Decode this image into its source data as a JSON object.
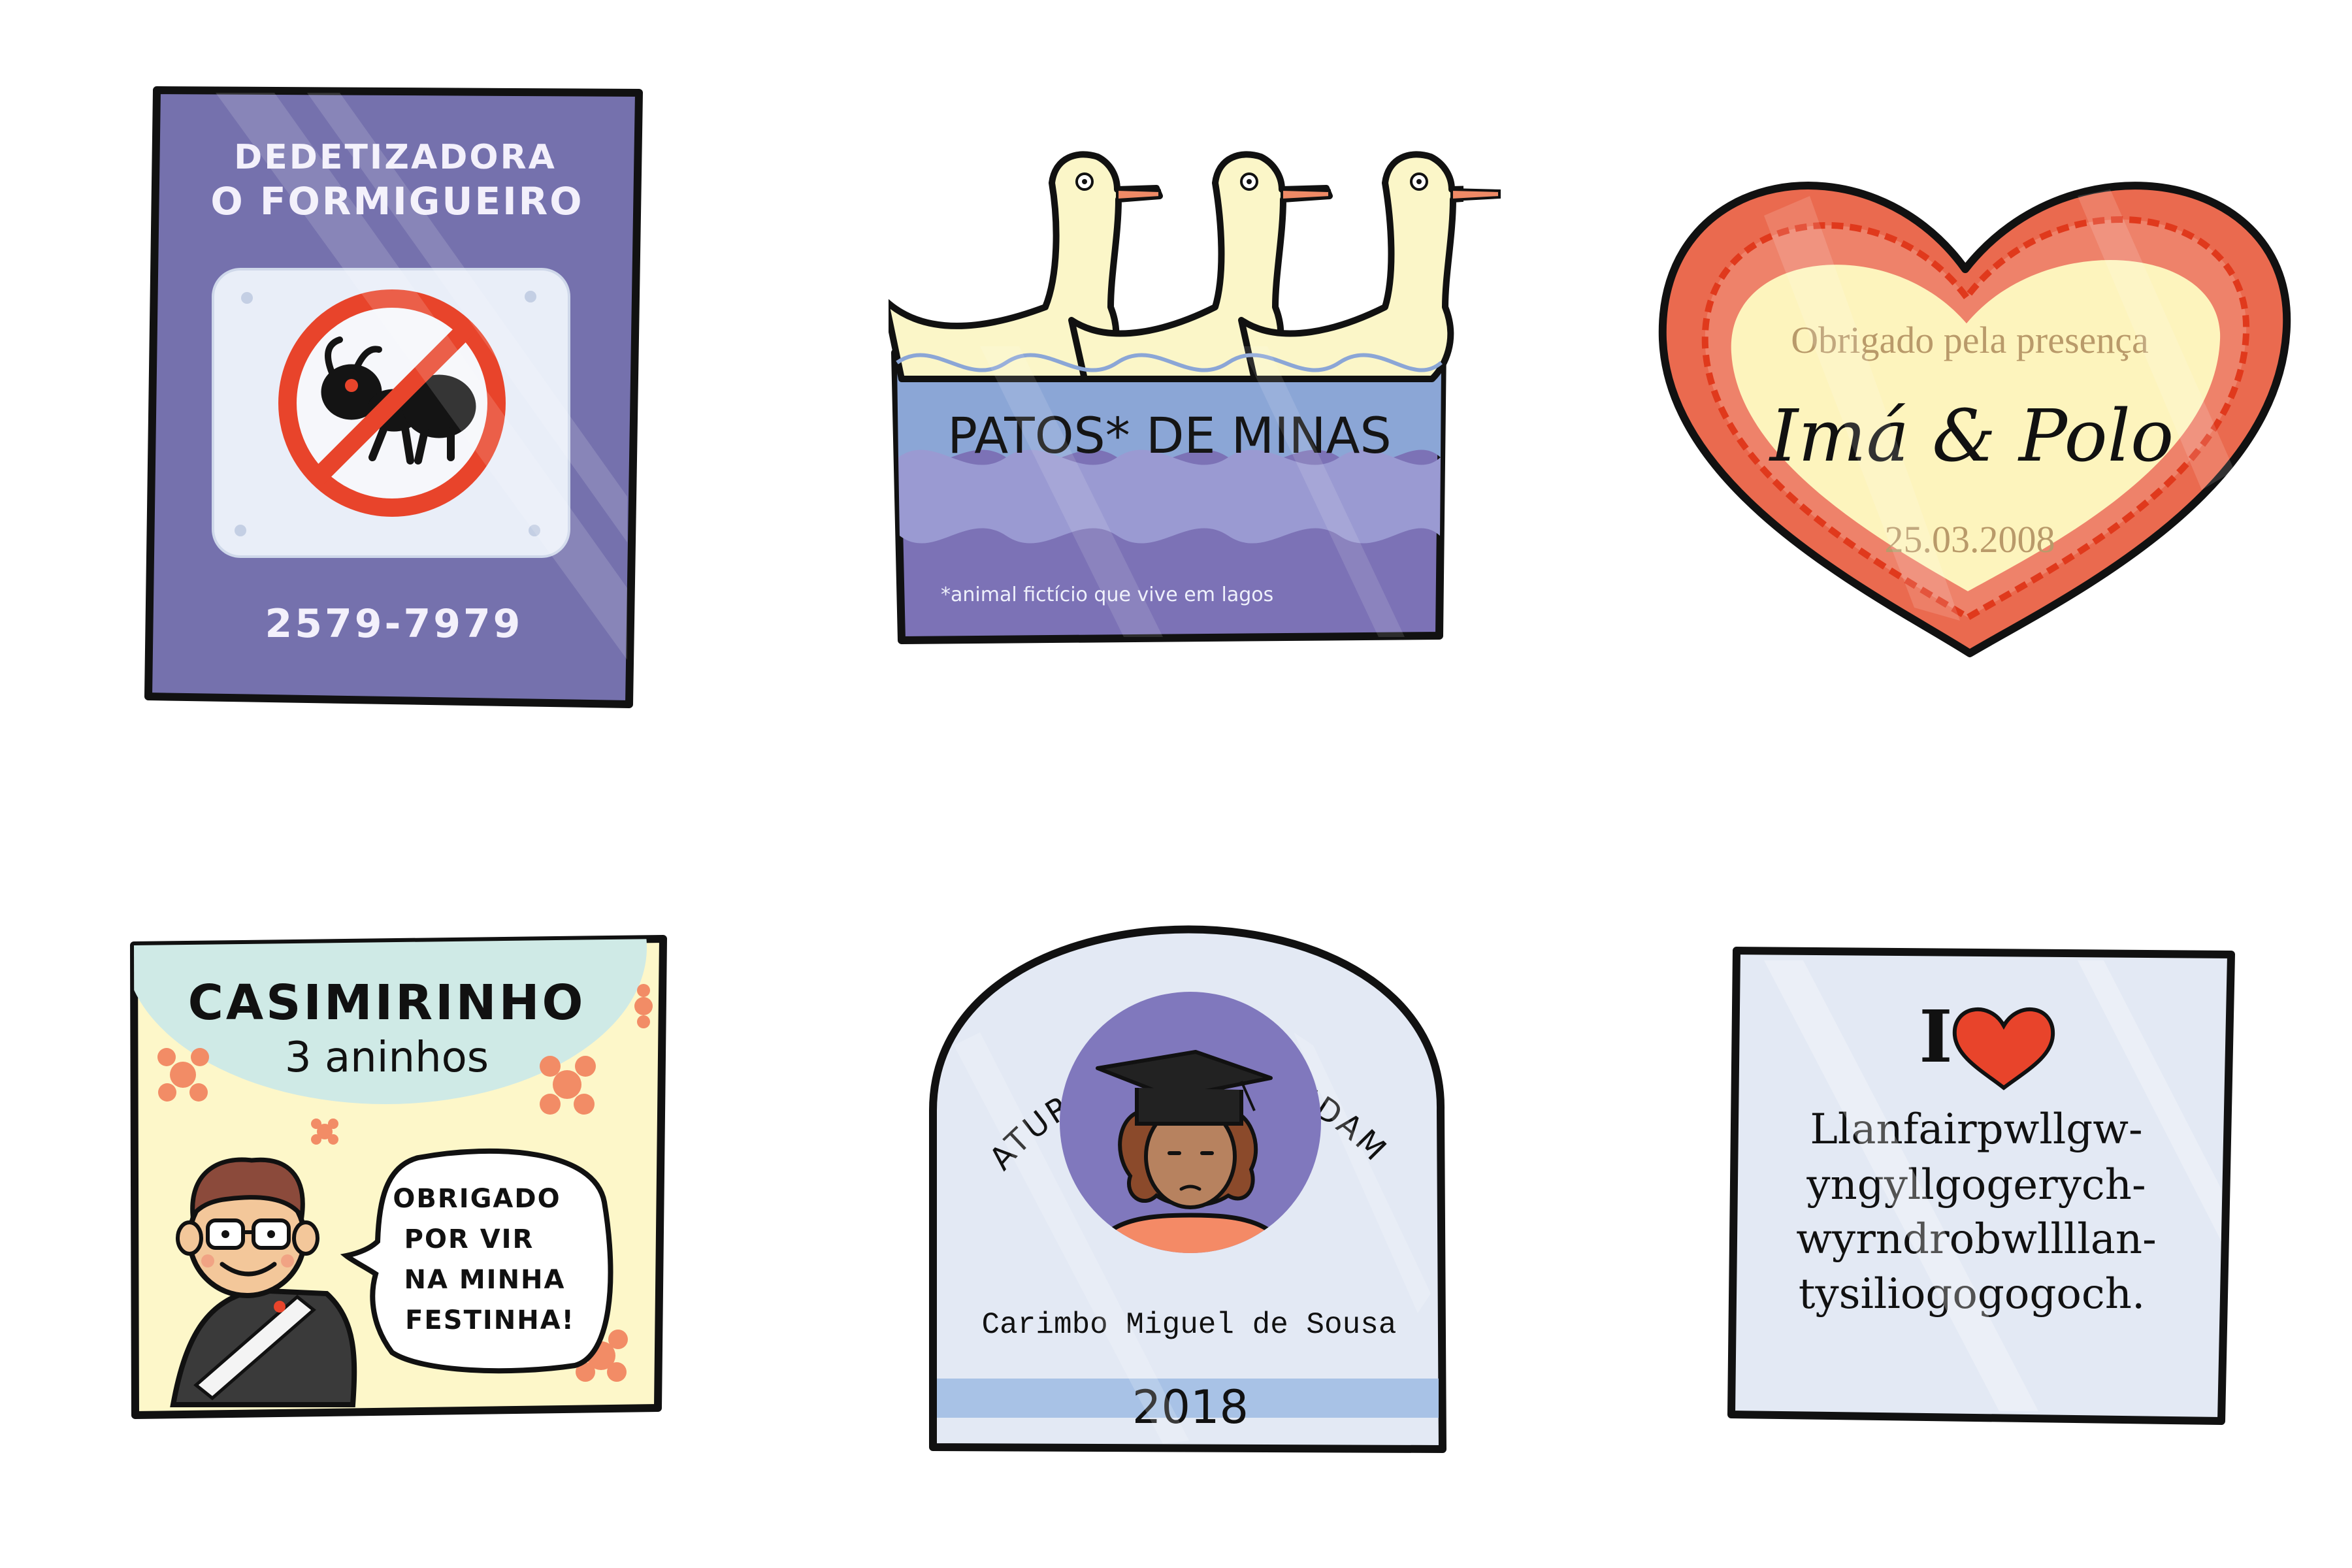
{
  "palette": {
    "background": "#ffffff",
    "outline": "#111111",
    "purple": "#7571ad",
    "purple_dark": "#6b64a8",
    "pale_blue": "#e3e9f4",
    "water_blue": "#8ba6d6",
    "water_purple": "#7c72b6",
    "duck_cream": "#fbf6c8",
    "beak_orange": "#ef8a66",
    "heart_red": "#ea4b2e",
    "heart_coral": "#ee826a",
    "heart_cream": "#fdf4bd",
    "muted_gold": "#b99a6a",
    "card_yellow": "#fdf7c9",
    "mint": "#cfeae6",
    "flower_orange": "#f28c66",
    "badge_purple": "#8078bd",
    "shirt_orange": "#f48a66",
    "stripe_blue": "#a8c2e6"
  },
  "stickers": {
    "pest_control": {
      "title_line1": "DEDETIZADORA",
      "title_line2": "O FORMIGUEIRO",
      "phone": "2579-7979",
      "icon": "no-ants-icon"
    },
    "ducks": {
      "title": "PATOS* DE MINAS",
      "footnote": "*animal fictício que vive em lagos",
      "icon": "duck-icon"
    },
    "wedding": {
      "thanks": "Obrigado pela presença",
      "names": "Imá & Polo",
      "date": "25.03.2008",
      "icon": "heart-icon"
    },
    "birthday": {
      "name": "CASIMIRINHO",
      "age": "3 aninhos",
      "speech_line1": "OBRIGADO",
      "speech_line2": "POR VIR",
      "speech_line3": "NA MINHA",
      "speech_line4": "FESTINHA!",
      "icon": "flower-icon"
    },
    "graduation": {
      "arc_title": "FORMATURA DO EN. FUNDAMENTAL",
      "name": "Carimbo Miguel de Sousa",
      "year": "2018",
      "icon": "graduation-cap-icon"
    },
    "place": {
      "prefix": "I",
      "icon": "heart-icon",
      "line1": "Llanfairpwllgw-",
      "line2": "yngyllgogerych-",
      "line3": "wyrndrobwllllan-",
      "line4": "tysiliogogogoch."
    }
  }
}
